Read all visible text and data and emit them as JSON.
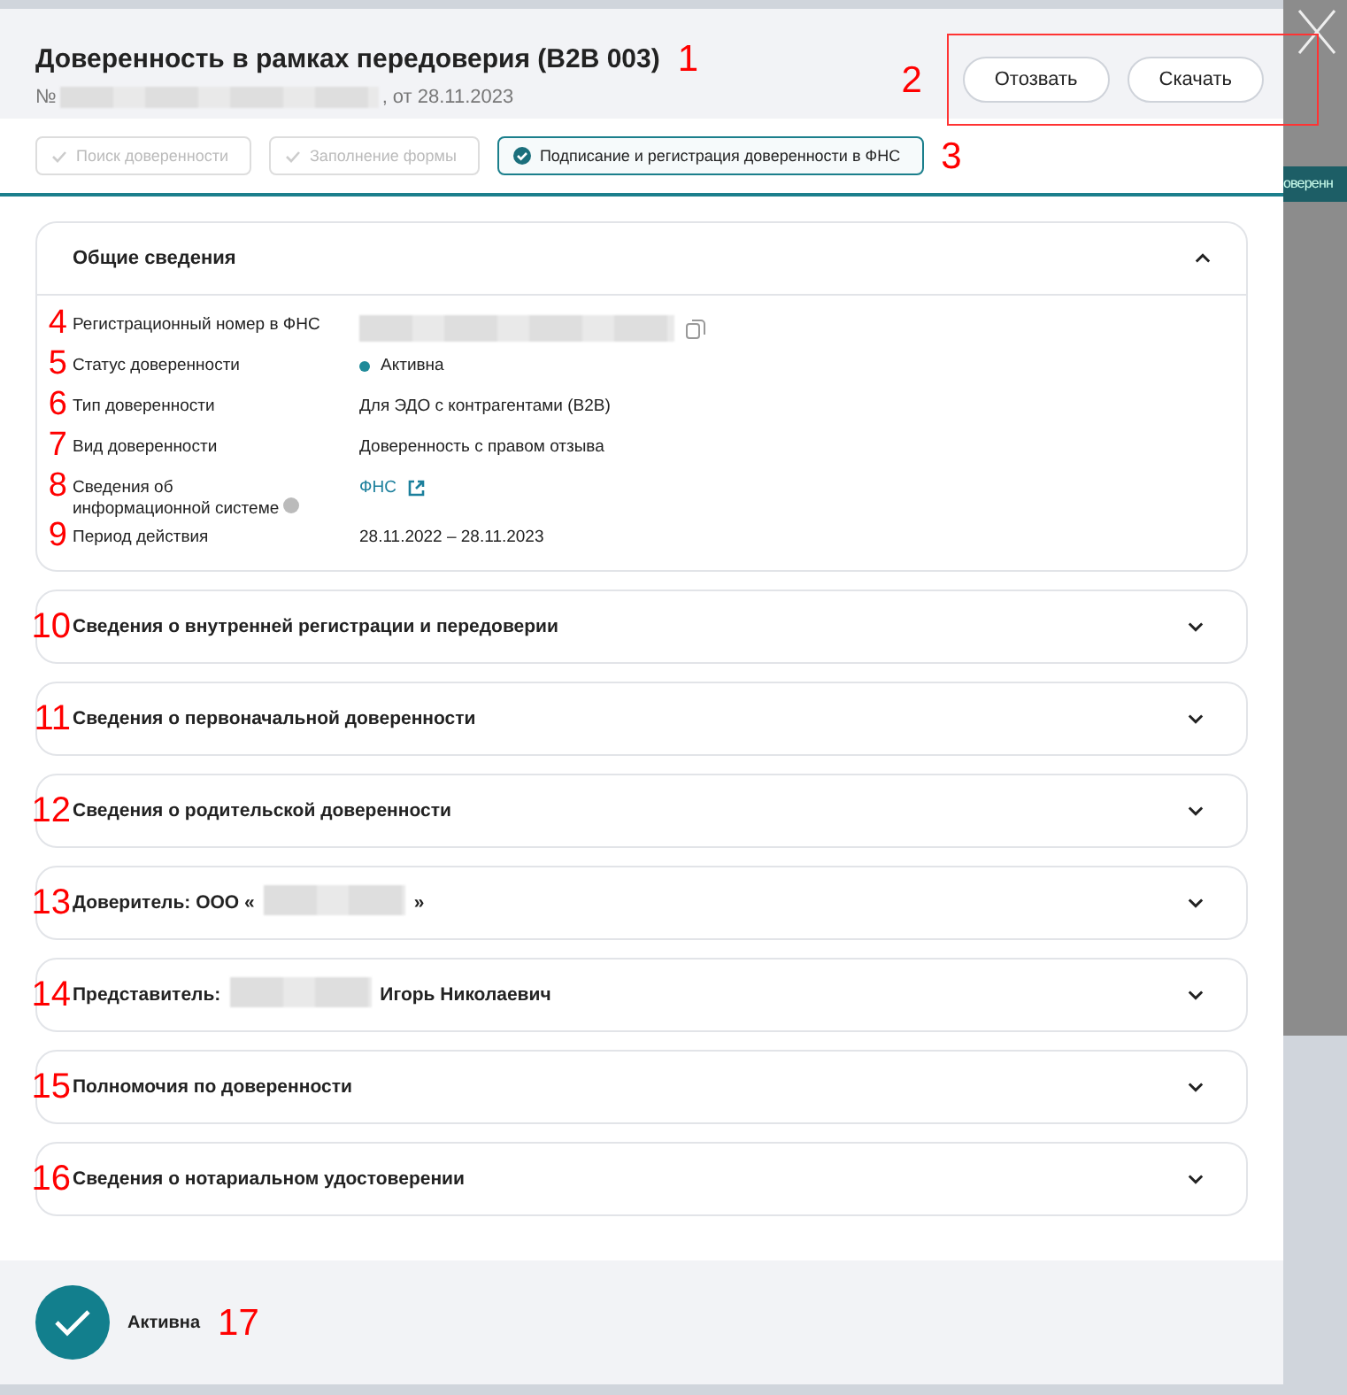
{
  "header": {
    "title": "Доверенность в рамках передоверия (B2B 003)",
    "title_marker": "1",
    "number_prefix": "№",
    "number_suffix": ", от 28.11.2023",
    "actions_marker": "2",
    "buttons": [
      "Отозвать",
      "Скачать"
    ]
  },
  "background": {
    "tab_fragment": "оверенн"
  },
  "steps": {
    "marker": "3",
    "items": [
      {
        "label": "Поиск доверенности",
        "selected": false
      },
      {
        "label": "Заполнение формы",
        "selected": false
      },
      {
        "label": "Подписание и регистрация доверенности в ФНС",
        "selected": true
      }
    ]
  },
  "general": {
    "title": "Общие сведения",
    "expanded": true,
    "rows": [
      {
        "marker": "4",
        "label": "Регистрационный номер в ФНС",
        "kind": "redacted"
      },
      {
        "marker": "5",
        "label": "Статус доверенности",
        "kind": "status",
        "value": "Активна",
        "color": "#1f8a99"
      },
      {
        "marker": "6",
        "label": "Тип доверенности",
        "kind": "text",
        "value": "Для ЭДО с контрагентами (B2B)"
      },
      {
        "marker": "7",
        "label": "Вид доверенности",
        "kind": "text",
        "value": "Доверенность с правом отзыва"
      },
      {
        "marker": "8",
        "label": "Сведения об информационной системе",
        "help": true,
        "kind": "link",
        "value": "ФНС"
      },
      {
        "marker": "9",
        "label": "Период действия",
        "kind": "text",
        "value": "28.11.2022 – 28.11.2023"
      }
    ]
  },
  "sections": [
    {
      "marker": "10",
      "expanded": false,
      "segments": [
        {
          "kind": "text",
          "text": "Сведения о внутренней регистрации и передоверии"
        }
      ]
    },
    {
      "marker": "11",
      "expanded": false,
      "segments": [
        {
          "kind": "text",
          "text": "Сведения о первоначальной доверенности"
        }
      ]
    },
    {
      "marker": "12",
      "expanded": false,
      "segments": [
        {
          "kind": "text",
          "text": "Сведения о родительской доверенности"
        }
      ]
    },
    {
      "marker": "13",
      "expanded": false,
      "segments": [
        {
          "kind": "text",
          "text": "Доверитель: ООО «"
        },
        {
          "kind": "redacted"
        },
        {
          "kind": "text",
          "text": "»"
        }
      ]
    },
    {
      "marker": "14",
      "expanded": false,
      "segments": [
        {
          "kind": "text",
          "text": "Представитель:"
        },
        {
          "kind": "redacted"
        },
        {
          "kind": "text",
          "text": "Игорь Николаевич"
        }
      ]
    },
    {
      "marker": "15",
      "expanded": false,
      "segments": [
        {
          "kind": "text",
          "text": "Полномочия по доверенности"
        }
      ]
    },
    {
      "marker": "16",
      "expanded": false,
      "segments": [
        {
          "kind": "text",
          "text": "Сведения о нотариальном удостоверении"
        }
      ]
    }
  ],
  "footer": {
    "status": "Активна",
    "marker": "17"
  }
}
